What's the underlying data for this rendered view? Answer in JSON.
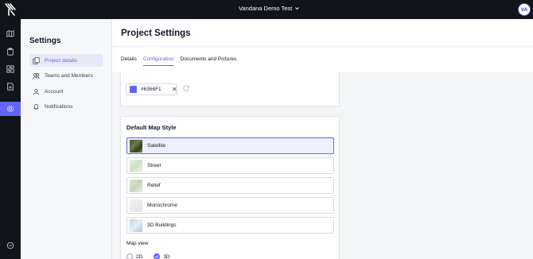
{
  "topbar": {
    "project_name": "Vandana Demo Test",
    "avatar_initials": "VA"
  },
  "rail": {
    "items": [
      {
        "icon": "map-icon"
      },
      {
        "icon": "clipboard-icon"
      },
      {
        "icon": "dashboard-icon"
      },
      {
        "icon": "document-icon"
      },
      {
        "icon": "gear-icon",
        "active": true
      }
    ],
    "bottom_icon": "chat-icon"
  },
  "sidebar": {
    "title": "Settings",
    "items": [
      {
        "label": "Project details",
        "icon": "project-icon",
        "active": true
      },
      {
        "label": "Teams and Members",
        "icon": "team-icon"
      },
      {
        "label": "Account",
        "icon": "user-icon"
      },
      {
        "label": "Notifications",
        "icon": "bell-icon"
      }
    ]
  },
  "page": {
    "title": "Project Settings",
    "tabs": [
      {
        "label": "Details"
      },
      {
        "label": "Configuration",
        "active": true
      },
      {
        "label": "Documents and Pictures"
      }
    ]
  },
  "color_section": {
    "hex_value": "#6366F1",
    "swatch_color": "#6366F1"
  },
  "map_style": {
    "heading": "Default Map Style",
    "options": [
      {
        "label": "Satellite",
        "selected": true
      },
      {
        "label": "Street"
      },
      {
        "label": "Relief"
      },
      {
        "label": "Monochrome"
      },
      {
        "label": "3D Buildings"
      }
    ],
    "view_label": "Map view",
    "views": [
      {
        "label": "2D",
        "checked": false
      },
      {
        "label": "3D",
        "checked": true
      }
    ]
  },
  "colors": {
    "accent": "#6366F1",
    "topbar": "#111418"
  }
}
